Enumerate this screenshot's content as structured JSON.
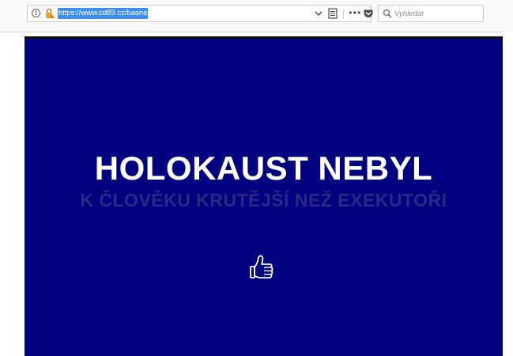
{
  "browser": {
    "url": "https://www.cd89.cz/basne",
    "search_placeholder": "Vyhledat",
    "icons": {
      "info": "info-icon",
      "lock": "lock-icon",
      "dropdown": "chevron-down-icon",
      "reader": "reader-view-icon",
      "more": "more-icon",
      "pocket": "pocket-icon",
      "bookmark": "star-icon",
      "search": "search-icon"
    }
  },
  "page": {
    "headline": "HOLOKAUST NEBYL",
    "subline": "K ČLOVĚKU KRUTĚJŠÍ NEŽ EXEKUTOŘI",
    "background_color": "#020280",
    "headline_color": "#ffffff",
    "subline_color": "#2a2a86",
    "like_icon": "thumbs-up-icon"
  }
}
